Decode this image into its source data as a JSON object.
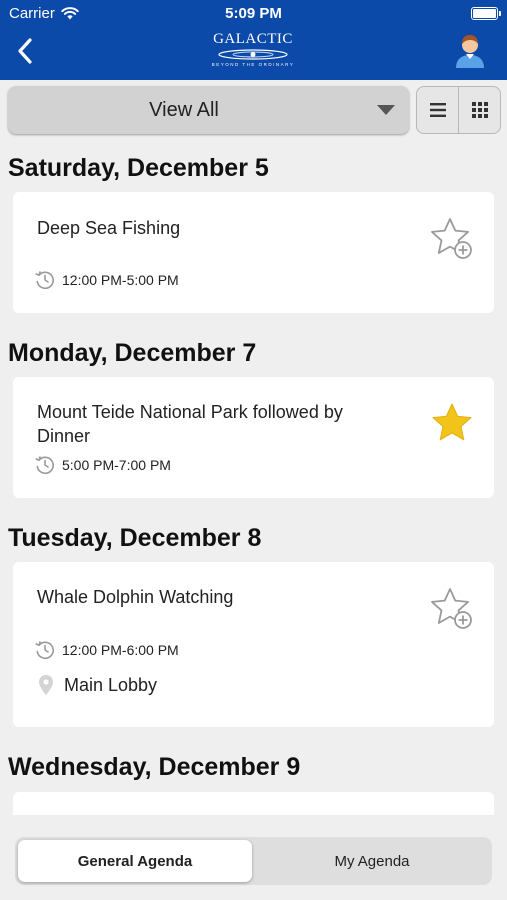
{
  "status_bar": {
    "carrier": "Carrier",
    "time": "5:09 PM"
  },
  "header": {
    "logo_text": "GALACTIC",
    "logo_tagline": "BEYOND THE ORDINARY"
  },
  "filter": {
    "selected": "View All"
  },
  "days": [
    {
      "label": "Saturday, December 5"
    },
    {
      "label": "Monday, December 7"
    },
    {
      "label": "Tuesday, December 8"
    },
    {
      "label": "Wednesday, December 9"
    }
  ],
  "events": [
    {
      "title": "Deep Sea Fishing",
      "time": "12:00 PM-5:00 PM",
      "location": "",
      "favorited": false
    },
    {
      "title": "Mount Teide National Park followed by Dinner",
      "time": "5:00 PM-7:00 PM",
      "location": "",
      "favorited": true
    },
    {
      "title": "Whale Dolphin Watching",
      "time": "12:00 PM-6:00 PM",
      "location": "Main Lobby",
      "favorited": false
    }
  ],
  "tabs": [
    {
      "label": "General Agenda",
      "active": true
    },
    {
      "label": "My Agenda",
      "active": false
    }
  ],
  "colors": {
    "header": "#0b4aa8",
    "star_active": "#f2c318",
    "icon_gray": "#9a9a9a"
  }
}
